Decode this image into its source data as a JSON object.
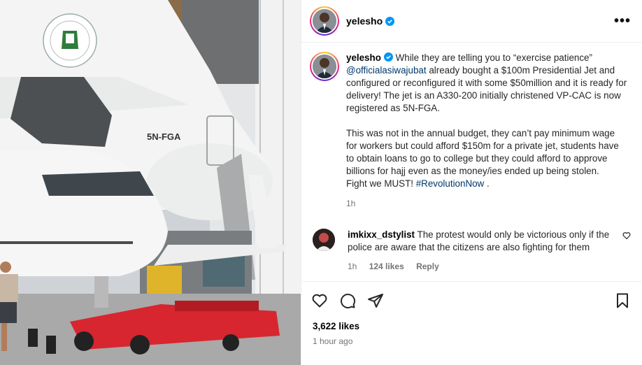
{
  "post": {
    "author": "yelesho",
    "caption_intro": "While they are telling you to “exercise patience” ",
    "mention": "@officialasiwajubat",
    "caption_p1_rest": " already bought a $100m Presidential Jet and configured or reconfigured it with some $50million and it is ready for delivery! The jet is an A330-200 initially christened VP-CAC is now registered as 5N-FGA.",
    "caption_p2": "This was not in the annual budget, they can’t pay minimum wage for workers but could afford $150m for a private jet, students have to obtain loans to go to college but they could afford to approve billions for hajj even as the money/ies ended up being stolen.",
    "caption_p3": "Fight we MUST! ",
    "hashtag": "#RevolutionNow",
    "caption_end": " .",
    "caption_time": "1h",
    "likes": "3,622 likes",
    "posted": "1 hour ago"
  },
  "image": {
    "tail_registration": "5N-FGA"
  },
  "comment": {
    "author": "imkixx_dstylist",
    "text": "The protest would only be victorious only if the police are aware that the citizens are also fighting for them",
    "time": "1h",
    "likes": "124 likes",
    "reply": "Reply"
  },
  "icons": {
    "more": "more-options-icon",
    "verified": "verified-badge-icon",
    "like": "heart-icon",
    "comment": "comment-icon",
    "share": "share-icon",
    "save": "bookmark-icon"
  },
  "colors": {
    "verified": "#0095f6",
    "link": "#00376b",
    "muted": "#737373"
  }
}
